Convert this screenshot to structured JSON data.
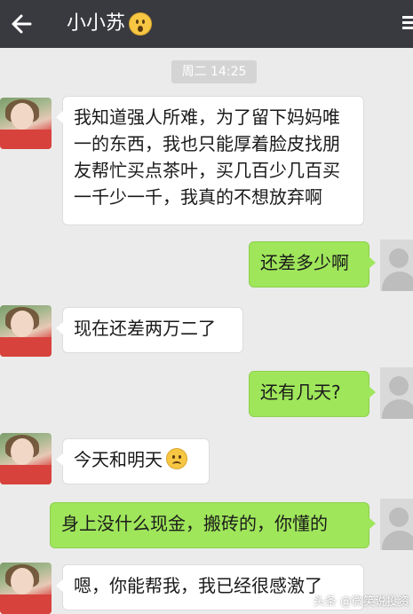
{
  "header": {
    "title": "小小苏",
    "back_icon": "back-arrow-icon",
    "more_icon": "more-icon"
  },
  "timestamp": "周二 14:25",
  "messages": [
    {
      "side": "in",
      "text": "我知道强人所难，为了留下妈妈唯一的东西，我也只能厚着脸皮找朋友帮忙买点茶叶，买几百少几百买一千少一千，我真的不想放弃啊"
    },
    {
      "side": "out",
      "text": "还差多少啊"
    },
    {
      "side": "in",
      "text": "现在还差两万二了"
    },
    {
      "side": "out",
      "text": "还有几天?"
    },
    {
      "side": "in",
      "text": "今天和明天"
    },
    {
      "side": "out",
      "text": "身上没什么现金，搬砖的，你懂的"
    },
    {
      "side": "in",
      "text": "嗯，你能帮我，我已经很感激了"
    }
  ],
  "watermark": "头条 @微笑说投资",
  "colors": {
    "topbar": "#393a3f",
    "background": "#ebebeb",
    "out_bubble": "#9fe65b",
    "in_bubble": "#ffffff"
  }
}
